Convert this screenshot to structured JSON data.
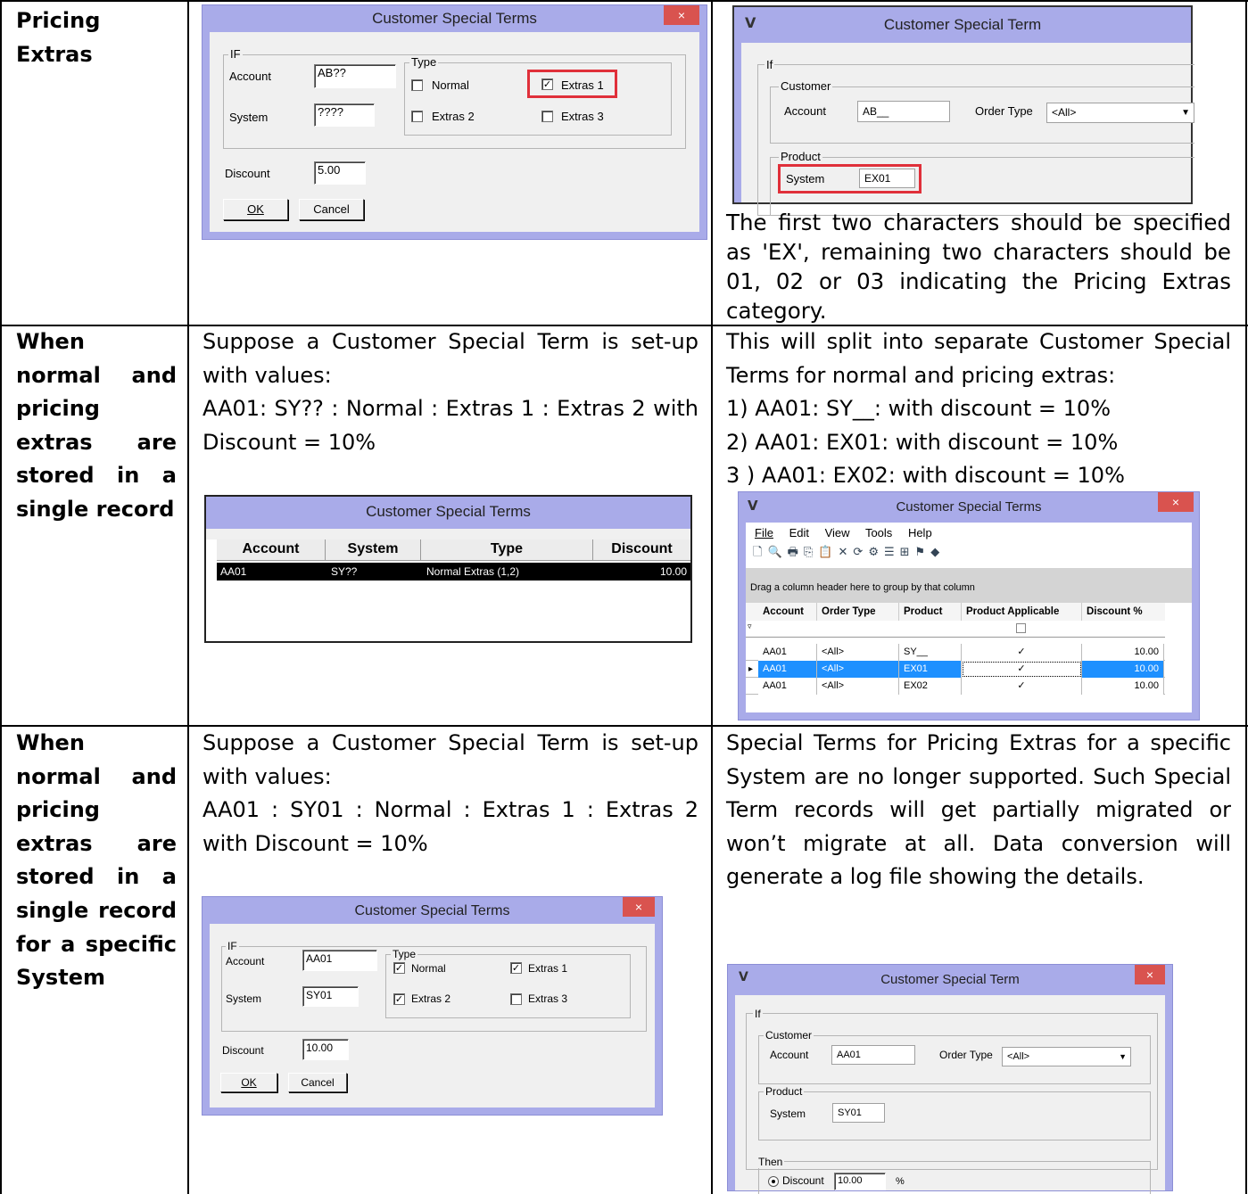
{
  "rows": [
    {
      "heading": "Pricing Extras",
      "right_text": "The first two characters should be specified as 'EX', remaining two characters should be 01, 02 or 03 indicating the Pricing Extras category."
    },
    {
      "heading": "When normal and pricing extras are stored in a single record",
      "middle_lines": [
        "Suppose a Customer Special Term  is  set-up with values:",
        "AA01: SY?? : Normal : Extras 1 : Extras 2 with Discount = 10%"
      ],
      "right_lines": [
        "This will split into separate Customer Special Terms for normal and pricing extras:",
        "1)  AA01: SY__: with discount = 10%",
        "2)  AA01: EX01: with discount = 10%",
        "3 ) AA01: EX02: with discount = 10%"
      ]
    },
    {
      "heading": "When normal and pricing extras are stored in a single record for a specific System",
      "middle_lines": [
        "Suppose a Customer Special Term  is  set-up with values:",
        "AA01 : SY01 : Normal : Extras 1 : Extras 2 with Discount = 10%"
      ],
      "right_text": "Special Terms for Pricing Extras for a specific System are no longer supported. Such Special Term records will get partially migrated or won’t migrate at all. Data conversion will generate a log file showing the details."
    }
  ],
  "dlg1": {
    "title": "Customer Special Terms",
    "close": "×",
    "if_label": "IF",
    "account_label": "Account",
    "account_value": "AB??",
    "system_label": "System",
    "system_value": "????",
    "type_label": "Type",
    "normal": "Normal",
    "extras1": "Extras 1",
    "extras2": "Extras 2",
    "extras3": "Extras 3",
    "discount_label": "Discount",
    "discount_value": "5.00",
    "ok": "OK",
    "cancel": "Cancel"
  },
  "dlg2": {
    "title": "Customer Special Term",
    "if_label": "If",
    "customer_label": "Customer",
    "account_label": "Account",
    "account_value": "AB__",
    "order_type_label": "Order Type",
    "order_type_value": "<All>",
    "product_label": "Product",
    "system_label": "System",
    "system_value": "EX01"
  },
  "grid1": {
    "title": "Customer Special Terms",
    "columns": [
      "Account",
      "System",
      "Type",
      "Discount"
    ],
    "row": [
      "AA01",
      "SY??",
      "Normal Extras (1,2)",
      "10.00"
    ]
  },
  "grid2": {
    "title": "Customer Special Terms",
    "close": "×",
    "menu": [
      "File",
      "Edit",
      "View",
      "Tools",
      "Help"
    ],
    "group_hint": "Drag a column header here to group by that column",
    "columns": [
      "Account",
      "Order Type",
      "Product",
      "Product Applicable",
      "Discount %"
    ],
    "rows": [
      [
        "AA01",
        "<All>",
        "SY__",
        "✓",
        "10.00"
      ],
      [
        "AA01",
        "<All>",
        "EX01",
        "✓",
        "10.00"
      ],
      [
        "AA01",
        "<All>",
        "EX02",
        "✓",
        "10.00"
      ]
    ]
  },
  "dlg3": {
    "title": "Customer Special Terms",
    "close": "×",
    "if_label": "IF",
    "account_label": "Account",
    "account_value": "AA01",
    "system_label": "System",
    "system_value": "SY01",
    "type_label": "Type",
    "normal": "Normal",
    "extras1": "Extras 1",
    "extras2": "Extras 2",
    "extras3": "Extras 3",
    "discount_label": "Discount",
    "discount_value": "10.00",
    "ok": "OK",
    "cancel": "Cancel"
  },
  "dlg4": {
    "title": "Customer Special Term",
    "close": "×",
    "if_label": "If",
    "customer_label": "Customer",
    "account_label": "Account",
    "account_value": "AA01",
    "order_type_label": "Order Type",
    "order_type_value": "<All>",
    "product_label": "Product",
    "system_label": "System",
    "system_value": "SY01",
    "then_label": "Then",
    "discount_label": "Discount",
    "discount_value": "10.00",
    "percent": "%"
  }
}
